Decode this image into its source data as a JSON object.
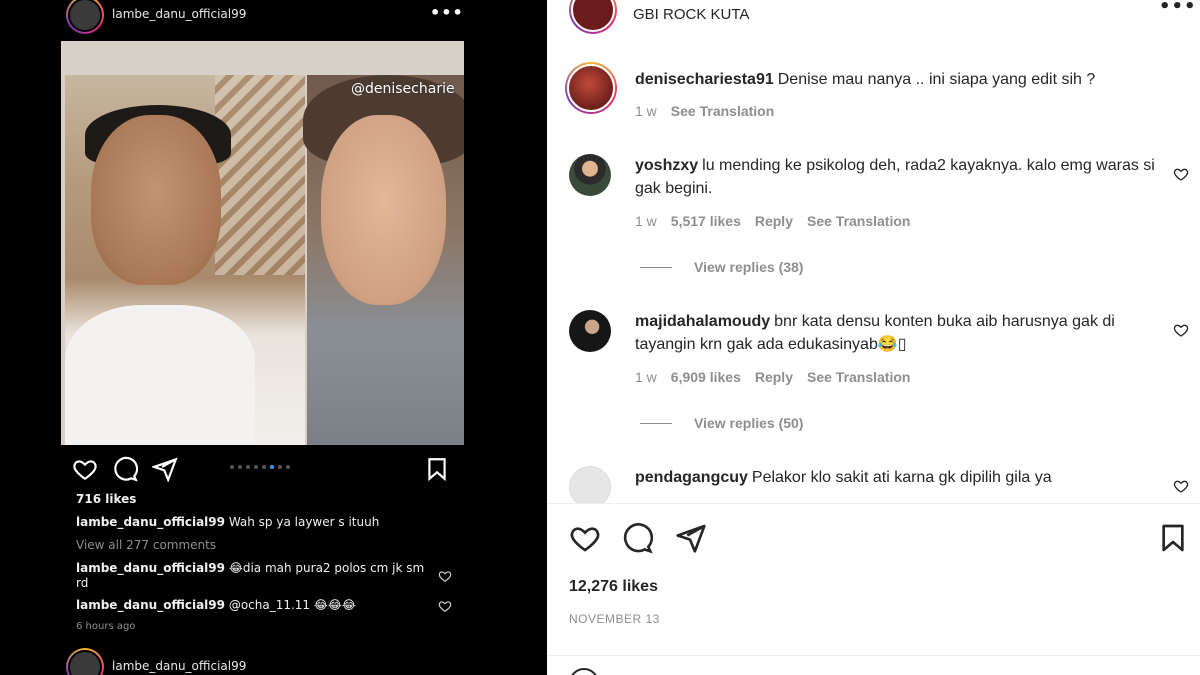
{
  "left_post": {
    "username": "lambe_danu_official99",
    "more": "•••",
    "watermark": "@denisecharie",
    "likes": "716 likes",
    "caption_user": "lambe_danu_official99",
    "caption_text": "Wah sp ya laywer s ituuh",
    "view_all": "View all 277 comments",
    "comments": [
      {
        "user": "lambe_danu_official99",
        "text": "😂dia mah pura2 polos cm jk sm rd"
      },
      {
        "user": "lambe_danu_official99",
        "text": "@ocha_11.11 😂😂😂"
      }
    ],
    "time": "6 hours ago",
    "next_username": "lambe_danu_official99"
  },
  "header": {
    "location": "GBI ROCK KUTA",
    "more": "•••"
  },
  "comments": [
    {
      "user": "denisechariesta91",
      "text": "Denise mau nanya .. ini siapa yang edit sih ?",
      "time": "1 w",
      "translate": "See Translation"
    },
    {
      "user": "yoshzxy",
      "text": "lu mending ke psikolog deh, rada2 kayaknya. kalo emg waras si gak begini.",
      "time": "1 w",
      "likes": "5,517 likes",
      "reply": "Reply",
      "translate": "See Translation",
      "view_replies": "View replies (38)"
    },
    {
      "user": "majidahalamoudy",
      "text": "bnr kata densu konten buka aib harusnya gak di tayangin krn gak ada edukasinyab😂▯",
      "time": "1 w",
      "likes": "6,909 likes",
      "reply": "Reply",
      "translate": "See Translation",
      "view_replies": "View replies (50)"
    },
    {
      "user": "pendagangcuy",
      "text": "Pelakor klo sakit ati karna gk dipilih gila ya"
    }
  ],
  "footer": {
    "likes": "12,276 likes",
    "date": "NOVEMBER 13"
  },
  "colors": {
    "link_blue": "#3b9cf0",
    "muted": "#8e8e8e",
    "text": "#262626"
  }
}
